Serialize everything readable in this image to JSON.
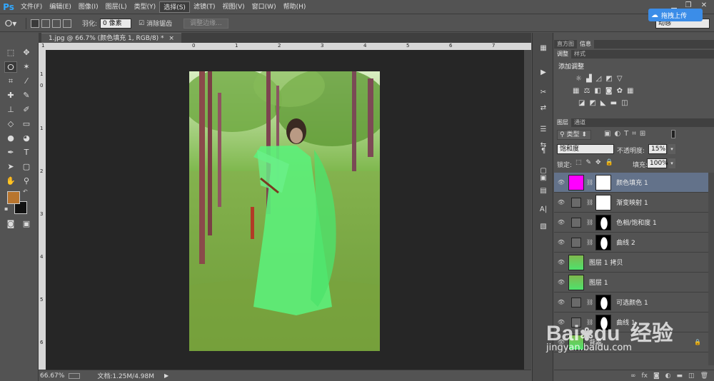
{
  "app": {
    "logo": "Ps"
  },
  "menu": [
    "文件(F)",
    "编辑(E)",
    "图像(I)",
    "图层(L)",
    "类型(Y)",
    "选择(S)",
    "滤镜(T)",
    "视图(V)",
    "窗口(W)",
    "帮助(H)"
  ],
  "menu_active_index": 5,
  "options": {
    "feather_label": "羽化:",
    "feather_value": "0 像素",
    "antialias_label": "消除锯齿",
    "refine_edge_label": "调整边缘...",
    "workspace_value": "动感"
  },
  "baidu_badge": "拖拽上传",
  "document": {
    "tab_title": "1.jpg @ 66.7% (颜色填充 1, RGB/8) *"
  },
  "rulers": {
    "h_ticks": [
      "1",
      "0",
      "1",
      "2",
      "3",
      "4",
      "5",
      "6",
      "7"
    ],
    "v_ticks": [
      "1",
      "0",
      "1",
      "2",
      "3",
      "4",
      "5",
      "6"
    ]
  },
  "status": {
    "zoom": "66.67%",
    "doc_info": "文档:1.25M/4.98M"
  },
  "colors": {
    "foreground": "#b8752e",
    "background": "#111111",
    "fill_layer": "#ff00ff",
    "selected_layer": "#63728a"
  },
  "panels": {
    "top_tabs": [
      "直方图",
      "信息"
    ],
    "adj_tabs": [
      "调整",
      "样式"
    ],
    "adj_title": "添加调整",
    "layers_tabs": [
      "图层",
      "通道"
    ],
    "kind_filter": "类型",
    "blend_mode": "饱和度",
    "opacity_label": "不透明度:",
    "opacity_value": "15%",
    "lock_label": "锁定:",
    "fill_label": "填充:",
    "fill_value": "100%"
  },
  "layers": [
    {
      "name": "颜色填充 1",
      "thumb": "magenta",
      "mask": "white",
      "selected": true
    },
    {
      "name": "渐变映射 1",
      "thumb": "adj",
      "mask": "white",
      "selected": false
    },
    {
      "name": "色相/饱和度 1",
      "thumb": "adj",
      "mask": "figure",
      "selected": false
    },
    {
      "name": "曲线 2",
      "thumb": "adj",
      "mask": "figure",
      "selected": false
    },
    {
      "name": "图层 1 拷贝",
      "thumb": "photo",
      "mask": "",
      "selected": false
    },
    {
      "name": "图层 1",
      "thumb": "photo",
      "mask": "",
      "selected": false
    },
    {
      "name": "可选颜色 1",
      "thumb": "adj",
      "mask": "figure",
      "selected": false
    },
    {
      "name": "曲线 1",
      "thumb": "adj",
      "mask": "figure",
      "selected": false
    },
    {
      "name": "背景",
      "thumb": "photo",
      "mask": "",
      "selected": false
    }
  ],
  "watermark": {
    "brand": "Bai",
    "brand2": "du",
    "cn": "经验",
    "url": "jingyan.baidu.com"
  }
}
